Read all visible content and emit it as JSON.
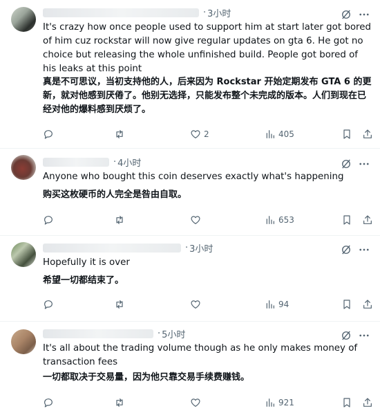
{
  "replies": [
    {
      "time": "3小时",
      "text_en": "It's crazy how once people used to support him at start later got bored of him cuz rockstar will now give regular updates on gta 6. He got no choice but releasing the whole unfinished build. People got bored of his leaks at this point",
      "text_zh": "真是不可思议，当初支持他的人，后来因为 Rockstar 开始定期发布 GTA 6 的更新，就对他感到厌倦了。他别无选择，只能发布整个未完成的版本。人们到现在已经对他的爆料感到厌烦了。",
      "replies_count": "",
      "reposts_count": "",
      "likes_count": "2",
      "views_count": "405"
    },
    {
      "time": "4小时",
      "text_en": "Anyone who bought this coin deserves exactly what's happening",
      "text_zh": "购买这枚硬币的人完全是咎由自取。",
      "replies_count": "",
      "reposts_count": "",
      "likes_count": "",
      "views_count": "653"
    },
    {
      "time": "3小时",
      "text_en": "Hopefully it is over",
      "text_zh": "希望一切都结束了。",
      "replies_count": "",
      "reposts_count": "",
      "likes_count": "",
      "views_count": "94"
    },
    {
      "time": "5小时",
      "text_en": "It's all about the trading volume though as he only makes money of transaction fees",
      "text_zh": "一切都取决于交易量，因为他只靠交易手续费赚钱。",
      "replies_count": "",
      "reposts_count": "",
      "likes_count": "",
      "views_count": "921"
    }
  ],
  "icons": {
    "grok": "grok-icon",
    "more": "more-icon",
    "reply": "reply-icon",
    "repost": "repost-icon",
    "like": "like-icon",
    "views": "views-icon",
    "bookmark": "bookmark-icon",
    "share": "share-icon"
  },
  "colors": {
    "text": "#0f1419",
    "muted": "#536471",
    "divider": "#eff3f4"
  }
}
